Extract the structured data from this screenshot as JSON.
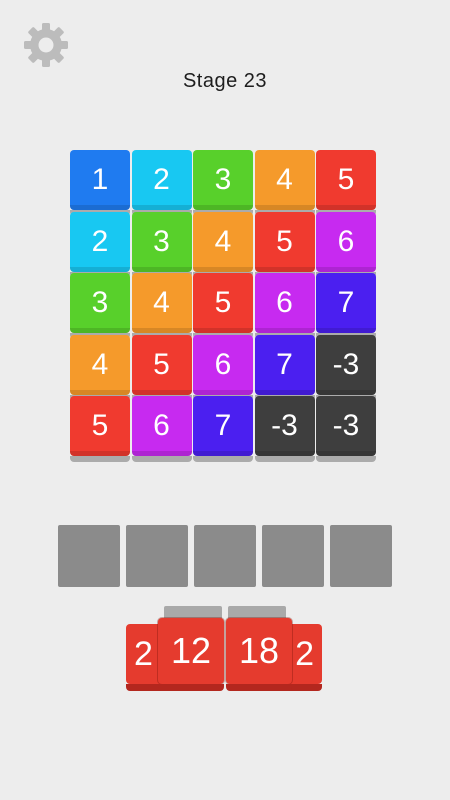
{
  "stage": {
    "title": "Stage 23"
  },
  "icons": {
    "settings": "gear-icon"
  },
  "board": {
    "rows": [
      [
        {
          "label": "1",
          "color": "#1f7bf0"
        },
        {
          "label": "2",
          "color": "#18c8f2"
        },
        {
          "label": "3",
          "color": "#58d02b"
        },
        {
          "label": "4",
          "color": "#f59a2b"
        },
        {
          "label": "5",
          "color": "#f03a2f"
        }
      ],
      [
        {
          "label": "2",
          "color": "#18c8f2"
        },
        {
          "label": "3",
          "color": "#58d02b"
        },
        {
          "label": "4",
          "color": "#f59a2b"
        },
        {
          "label": "5",
          "color": "#f03a2f"
        },
        {
          "label": "6",
          "color": "#c72af0"
        }
      ],
      [
        {
          "label": "3",
          "color": "#58d02b"
        },
        {
          "label": "4",
          "color": "#f59a2b"
        },
        {
          "label": "5",
          "color": "#f03a2f"
        },
        {
          "label": "6",
          "color": "#c72af0"
        },
        {
          "label": "7",
          "color": "#4b1ff0"
        }
      ],
      [
        {
          "label": "4",
          "color": "#f59a2b"
        },
        {
          "label": "5",
          "color": "#f03a2f"
        },
        {
          "label": "6",
          "color": "#c72af0"
        },
        {
          "label": "7",
          "color": "#4b1ff0"
        },
        {
          "label": "-3",
          "color": "#3e3e3e"
        }
      ],
      [
        {
          "label": "5",
          "color": "#f03a2f"
        },
        {
          "label": "6",
          "color": "#c72af0"
        },
        {
          "label": "7",
          "color": "#4b1ff0"
        },
        {
          "label": "-3",
          "color": "#3e3e3e"
        },
        {
          "label": "-3",
          "color": "#3e3e3e"
        }
      ]
    ]
  },
  "slots": {
    "count": 5,
    "color": "#8b8b8b"
  },
  "combo": {
    "back_tiles": [
      {
        "label": "2"
      },
      {
        "label": "2"
      }
    ],
    "front_tiles": [
      {
        "label": "12"
      },
      {
        "label": "18"
      }
    ],
    "color": "#e53b2e"
  }
}
